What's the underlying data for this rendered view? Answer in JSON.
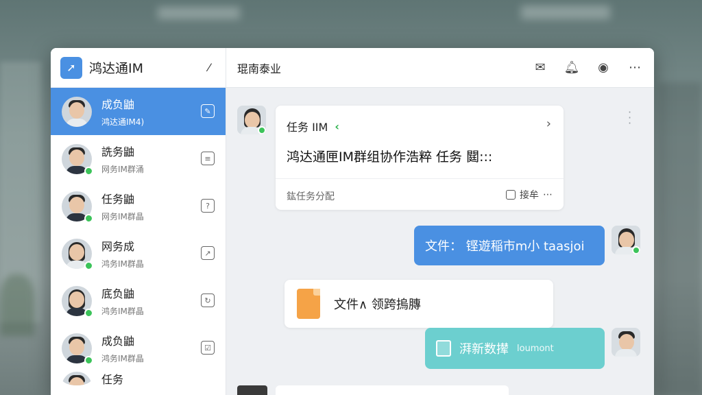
{
  "app": {
    "title": "鸿达通IM",
    "logo_icon": "rocket-icon"
  },
  "sidebar": {
    "items": [
      {
        "name": "成负鼬",
        "sub": "鸿达通IM4)",
        "icon": "note-icon",
        "active": true,
        "online": false,
        "hair": "short",
        "body": "light"
      },
      {
        "name": "詵务鼬",
        "sub": "网务IM群涌",
        "icon": "list-icon",
        "active": false,
        "online": true,
        "hair": "short",
        "body": "dark"
      },
      {
        "name": "任务鼬",
        "sub": "网务IM群晶",
        "icon": "clipboard-icon",
        "active": false,
        "online": true,
        "hair": "short",
        "body": "dark"
      },
      {
        "name": "网务成",
        "sub": "鸿务IM群晶",
        "icon": "share-icon",
        "active": false,
        "online": true,
        "hair": "long",
        "body": "light"
      },
      {
        "name": "底负鼬",
        "sub": "鸿务IM群晶",
        "icon": "refresh-icon",
        "active": false,
        "online": true,
        "hair": "long",
        "body": "dark"
      },
      {
        "name": "成负鼬",
        "sub": "鸿务IM群晶",
        "icon": "checklist-icon",
        "active": false,
        "online": true,
        "hair": "short",
        "body": "dark"
      }
    ],
    "partial_item_name": "任务"
  },
  "header": {
    "title": "琨南泰业",
    "icons": [
      "mail-icon",
      "bell-icon",
      "profile-icon",
      "more-icon"
    ]
  },
  "messages": {
    "task_card": {
      "head": "任务 IIM",
      "body": "鸿达通匣IM群组协作浩粹 任务 閮:::",
      "foot": "鈜任务分配",
      "action": "接牟"
    },
    "blue_bubble": {
      "text": "文件：  铿遊稲市m小 taasjoi"
    },
    "file_card": {
      "name": "文件∧ 领跨摀膞"
    },
    "teal_bubble": {
      "text": "湃新数撵",
      "tail": "loumont"
    }
  },
  "colors": {
    "accent": "#4a90e2",
    "online": "#3cc35a",
    "teal": "#6ccfcf",
    "file_orange": "#f5a347"
  }
}
